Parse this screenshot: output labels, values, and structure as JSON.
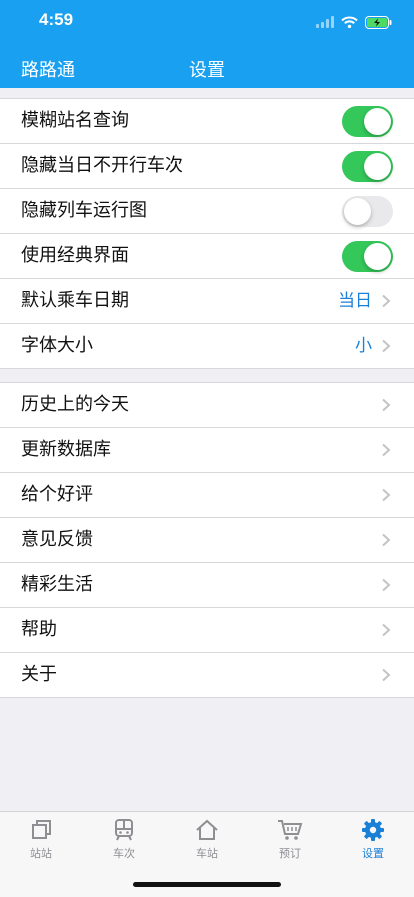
{
  "status": {
    "time": "4:59"
  },
  "nav": {
    "left": "路路通",
    "title": "设置"
  },
  "colors": {
    "header": "#1aa0f0",
    "accent": "#1a7fd6",
    "switch_on": "#34c759"
  },
  "settings": {
    "items": [
      {
        "label": "模糊站名查询",
        "type": "toggle",
        "on": true
      },
      {
        "label": "隐藏当日不开行车次",
        "type": "toggle",
        "on": true
      },
      {
        "label": "隐藏列车运行图",
        "type": "toggle",
        "on": false
      },
      {
        "label": "使用经典界面",
        "type": "toggle",
        "on": true
      },
      {
        "label": "默认乘车日期",
        "type": "value",
        "value": "当日"
      },
      {
        "label": "字体大小",
        "type": "value",
        "value": "小"
      }
    ]
  },
  "more": {
    "items": [
      {
        "label": "历史上的今天"
      },
      {
        "label": "更新数据库"
      },
      {
        "label": "给个好评"
      },
      {
        "label": "意见反馈"
      },
      {
        "label": "精彩生活"
      },
      {
        "label": "帮助"
      },
      {
        "label": "关于"
      }
    ]
  },
  "tabs": [
    {
      "label": "站站",
      "icon": "stations-icon",
      "active": false
    },
    {
      "label": "车次",
      "icon": "train-icon",
      "active": false
    },
    {
      "label": "车站",
      "icon": "home-icon",
      "active": false
    },
    {
      "label": "预订",
      "icon": "cart-icon",
      "active": false
    },
    {
      "label": "设置",
      "icon": "gear-icon",
      "active": true
    }
  ]
}
